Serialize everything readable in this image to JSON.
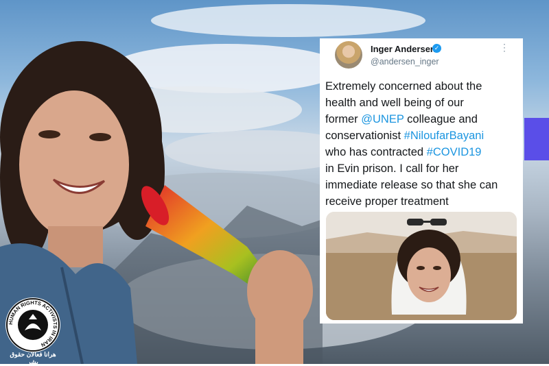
{
  "tweet": {
    "name": "Inger Andersen",
    "handle": "@andersen_inger",
    "text_lines": [
      [
        {
          "t": "Extremely concerned about the"
        }
      ],
      [
        {
          "t": "health and well being of our"
        }
      ],
      [
        {
          "t": "former "
        },
        {
          "t": "@UNEP",
          "link": true
        },
        {
          "t": " colleague and"
        }
      ],
      [
        {
          "t": "conservationist "
        },
        {
          "t": "#NiloufarBayani",
          "link": true
        }
      ],
      [
        {
          "t": "who has contracted "
        },
        {
          "t": "#COVID19",
          "link": true
        }
      ],
      [
        {
          "t": "in Evin prison. I call for her"
        }
      ],
      [
        {
          "t": "immediate release so that she can"
        }
      ],
      [
        {
          "t": "receive proper treatment"
        }
      ]
    ],
    "icons": {
      "verified": "verified-badge-icon",
      "more": "more-options-icon"
    }
  },
  "logo": {
    "ring_text": "HUMAN RIGHTS ACTIVISTS IN IRAN",
    "caption": "هرانا فعالان حقوق بشر"
  },
  "colors": {
    "link": "#1b95e0",
    "verified": "#1d9bf0",
    "accent": "#5a4ee8"
  }
}
